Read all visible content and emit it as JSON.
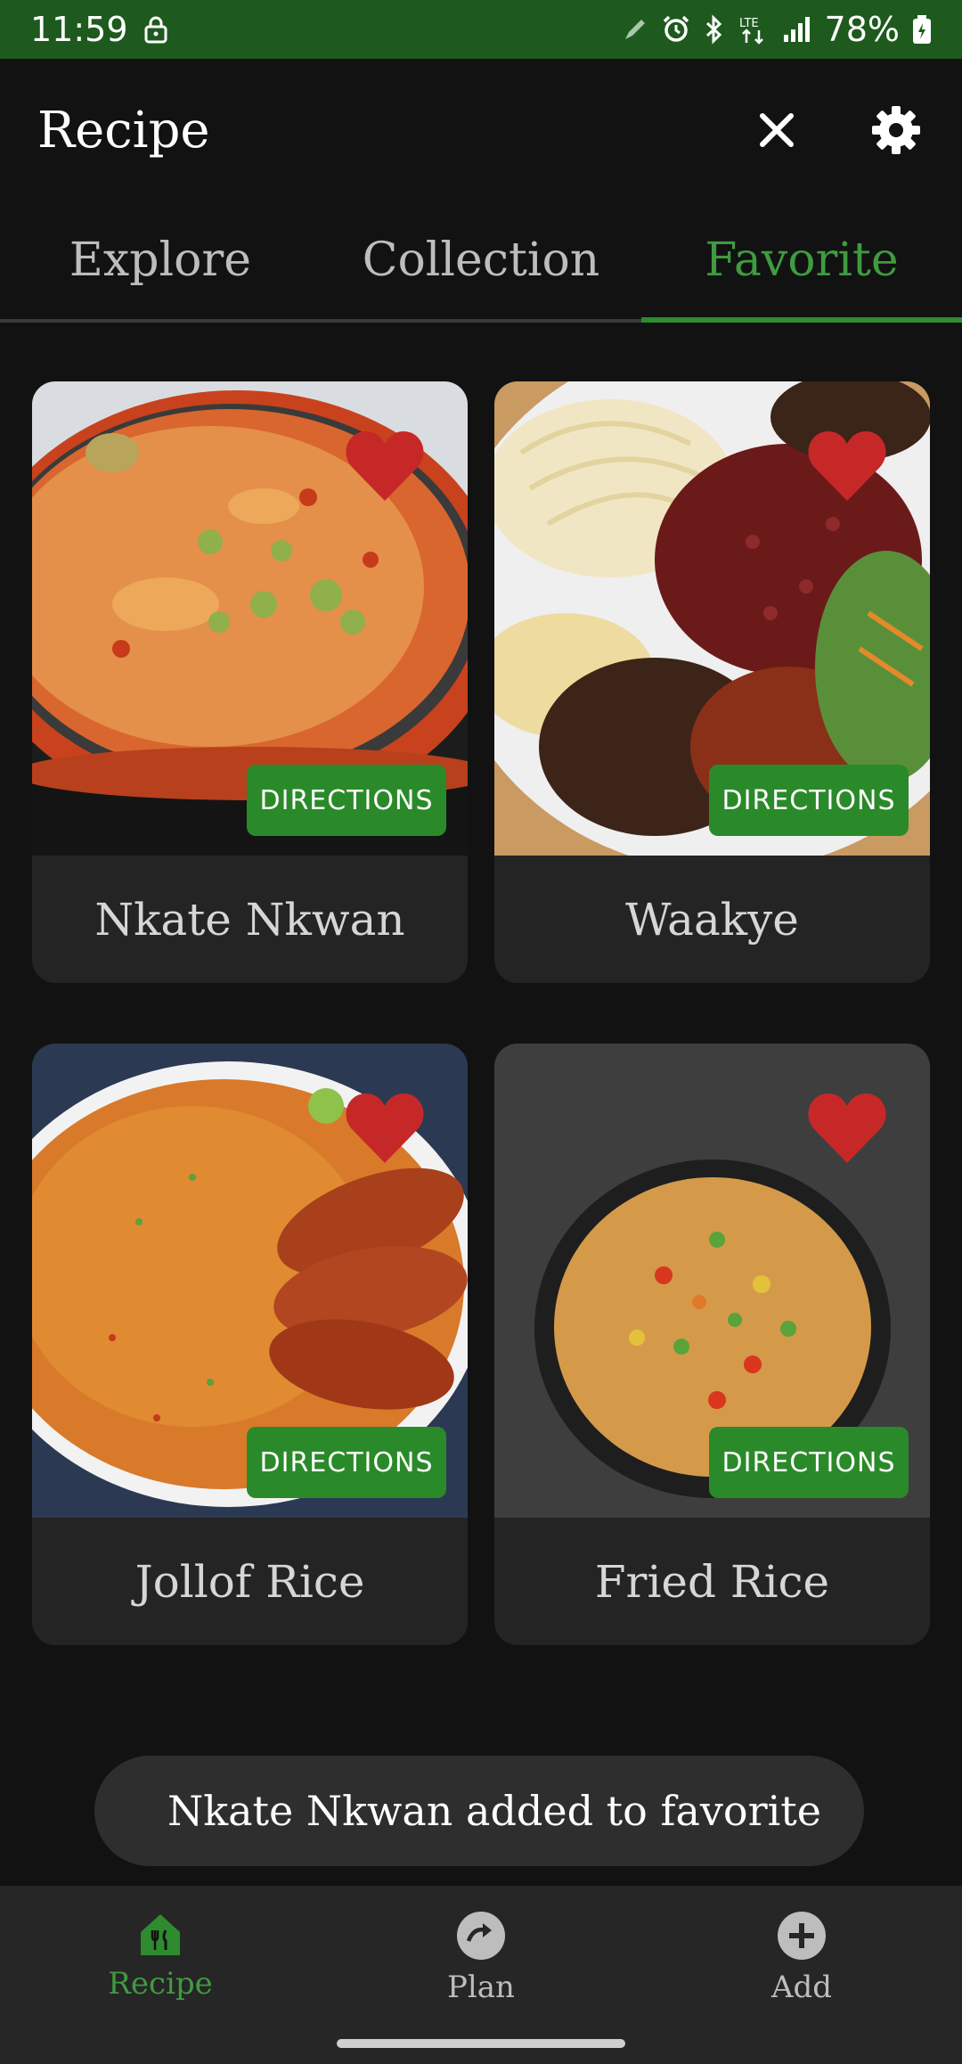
{
  "status_bar": {
    "time": "11:59",
    "battery": "78%",
    "icons": [
      "lock-icon",
      "pencil-icon",
      "alarm-icon",
      "bluetooth-icon",
      "lte-icon",
      "signal-icon",
      "battery-icon"
    ]
  },
  "app_bar": {
    "title": "Recipe",
    "actions": [
      "close-icon",
      "gear-icon"
    ]
  },
  "tabs": [
    {
      "label": "Explore",
      "active": false
    },
    {
      "label": "Collection",
      "active": false
    },
    {
      "label": "Favorite",
      "active": true
    }
  ],
  "cards": [
    {
      "title": "Nkate Nkwan",
      "button": "DIRECTIONS",
      "favorite": true
    },
    {
      "title": "Waakye",
      "button": "DIRECTIONS",
      "favorite": true
    },
    {
      "title": "Jollof Rice",
      "button": "DIRECTIONS",
      "favorite": true
    },
    {
      "title": "Fried Rice",
      "button": "DIRECTIONS",
      "favorite": true
    }
  ],
  "toast": {
    "message": "Nkate Nkwan added to favorite"
  },
  "bottom_nav": [
    {
      "label": "Recipe",
      "icon": "recipe-icon",
      "active": true
    },
    {
      "label": "Plan",
      "icon": "plan-icon",
      "active": false
    },
    {
      "label": "Add",
      "icon": "add-icon",
      "active": false
    }
  ],
  "colors": {
    "status_bar": "#1e5a1e",
    "accent": "#2e8b2e",
    "heart": "#c62828",
    "background": "#121212"
  }
}
